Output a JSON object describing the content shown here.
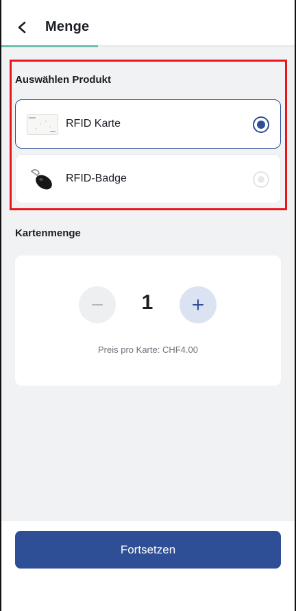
{
  "header": {
    "title": "Menge",
    "back_icon": "chevron-left-icon",
    "progress_fraction": 0.33
  },
  "product_section": {
    "title": "Auswählen Produkt",
    "products": [
      {
        "label": "RFID Karte",
        "thumbnail": "rfid-card-image",
        "selected": true
      },
      {
        "label": "RFID-Badge",
        "thumbnail": "rfid-badge-image",
        "selected": false
      }
    ]
  },
  "quantity_section": {
    "title": "Kartenmenge",
    "value": "1",
    "minus_icon": "minus-icon",
    "plus_icon": "plus-icon",
    "price_text": "Preis pro Karte: CHF4.00"
  },
  "footer": {
    "continue_label": "Fortsetzen"
  },
  "colors": {
    "primary": "#2e4f96",
    "progress": "#6fbfae",
    "highlight": "#e8151b",
    "background": "#f1f2f4"
  }
}
